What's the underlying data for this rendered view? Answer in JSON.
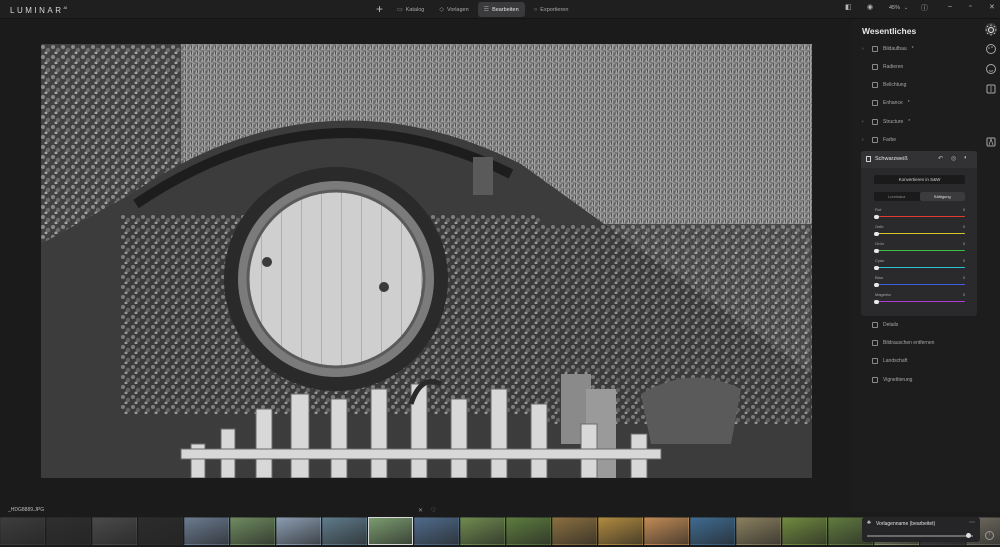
{
  "app": {
    "logo": "LUMINAR",
    "version": "AI"
  },
  "topbar": {
    "tabs": [
      {
        "label": "Katalog",
        "icon": "catalog-icon"
      },
      {
        "label": "Vorlagen",
        "icon": "templates-icon"
      },
      {
        "label": "Bearbeiten",
        "icon": "edit-icon",
        "active": true
      },
      {
        "label": "Exportieren",
        "icon": "export-icon"
      }
    ],
    "zoom": "45%"
  },
  "panel": {
    "title": "Wesentliches",
    "tools": [
      {
        "label": "Bildaufbau",
        "ai": true
      },
      {
        "label": "Radieren"
      },
      {
        "label": "Belichtung"
      },
      {
        "label": "Enhance",
        "ai": true
      },
      {
        "label": "Structure",
        "ai": true
      },
      {
        "label": "Farbe"
      }
    ],
    "tools_after": [
      {
        "label": "Details"
      },
      {
        "label": "Bildrauschen entfernen"
      },
      {
        "label": "Landschaft"
      },
      {
        "label": "Vignettierung"
      }
    ],
    "bw": {
      "title": "Schwarzweiß",
      "convert_label": "Konvertieren in S&W",
      "segments": [
        "Luminanz",
        "Sättigung"
      ],
      "active_segment": 1,
      "sliders": [
        {
          "label": "Rot",
          "value": "0",
          "color": "#e0392f"
        },
        {
          "label": "Gelb",
          "value": "0",
          "color": "#d8c32b"
        },
        {
          "label": "Grün",
          "value": "0",
          "color": "#3fbf45"
        },
        {
          "label": "Cyan",
          "value": "0",
          "color": "#2bc3d1"
        },
        {
          "label": "Blau",
          "value": "0",
          "color": "#3a5fe0"
        },
        {
          "label": "Magenta",
          "value": "0",
          "color": "#b03ad6"
        }
      ]
    }
  },
  "filmstrip": {
    "filename": "_HDG8889.JPG",
    "thumb_colors": [
      "#3d3d3d",
      "#2f2f2f",
      "#4a4a4a",
      "#2c2c2c",
      "#6a7a8f",
      "#6e8a5f",
      "#8a9cb0",
      "#5f7a8a",
      "#7a9c6f",
      "#4f6a8a",
      "#6f8a4f",
      "#5d7c3f",
      "#8a6f3f",
      "#b08a3f",
      "#c08a55",
      "#3f6a8f",
      "#8a7f5f",
      "#6f8a3f",
      "#5f7a3f",
      "#8a8f6f",
      "#3f3f3f",
      "#6f6a5f"
    ]
  },
  "preset": {
    "name": "Vorlagenname (bearbeitet)"
  }
}
